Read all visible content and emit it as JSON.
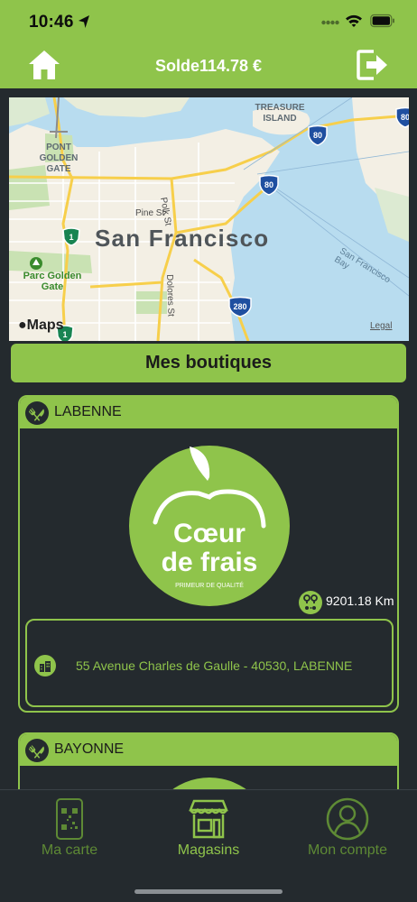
{
  "status_bar": {
    "time": "10:46"
  },
  "header": {
    "balance_label": "Solde114.78 €"
  },
  "map": {
    "city": "San Francisco",
    "labels": {
      "treasure_island": "TREASURE ISLAND",
      "golden_gate": "PONT GOLDEN GATE",
      "pine_st": "Pine St",
      "polk_st": "Polk St",
      "dolores_st": "Dolores St",
      "park": "Parc Golden Gate",
      "bay": "San Francisco Bay"
    },
    "shields": {
      "i80": "80",
      "us101": "1",
      "i280": "280"
    },
    "attribution": "Maps",
    "legal": "Legal"
  },
  "section": {
    "title": "Mes boutiques"
  },
  "stores": [
    {
      "name": "LABENNE",
      "logo_text_1": "Cœur",
      "logo_text_2": "de frais",
      "logo_tagline": "PRIMEUR DE QUALITÉ",
      "distance": "9201.18 Km",
      "address": "55 Avenue Charles de Gaulle - 40530, LABENNE"
    },
    {
      "name": "BAYONNE"
    }
  ],
  "tabs": [
    {
      "label": "Ma carte"
    },
    {
      "label": "Magasins"
    },
    {
      "label": "Mon compte"
    }
  ],
  "colors": {
    "accent": "#8fc44b",
    "background": "#242a2e",
    "inactive_tab": "#5e8a35"
  }
}
